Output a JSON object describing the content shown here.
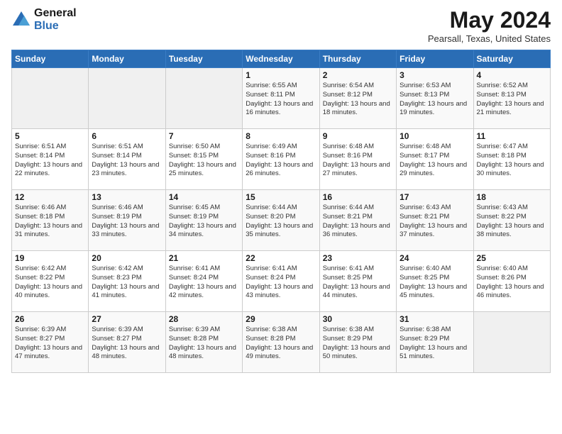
{
  "header": {
    "logo_line1": "General",
    "logo_line2": "Blue",
    "month_title": "May 2024",
    "location": "Pearsall, Texas, United States"
  },
  "weekdays": [
    "Sunday",
    "Monday",
    "Tuesday",
    "Wednesday",
    "Thursday",
    "Friday",
    "Saturday"
  ],
  "weeks": [
    [
      {
        "day": "",
        "info": ""
      },
      {
        "day": "",
        "info": ""
      },
      {
        "day": "",
        "info": ""
      },
      {
        "day": "1",
        "info": "Sunrise: 6:55 AM\nSunset: 8:11 PM\nDaylight: 13 hours and 16 minutes."
      },
      {
        "day": "2",
        "info": "Sunrise: 6:54 AM\nSunset: 8:12 PM\nDaylight: 13 hours and 18 minutes."
      },
      {
        "day": "3",
        "info": "Sunrise: 6:53 AM\nSunset: 8:13 PM\nDaylight: 13 hours and 19 minutes."
      },
      {
        "day": "4",
        "info": "Sunrise: 6:52 AM\nSunset: 8:13 PM\nDaylight: 13 hours and 21 minutes."
      }
    ],
    [
      {
        "day": "5",
        "info": "Sunrise: 6:51 AM\nSunset: 8:14 PM\nDaylight: 13 hours and 22 minutes."
      },
      {
        "day": "6",
        "info": "Sunrise: 6:51 AM\nSunset: 8:14 PM\nDaylight: 13 hours and 23 minutes."
      },
      {
        "day": "7",
        "info": "Sunrise: 6:50 AM\nSunset: 8:15 PM\nDaylight: 13 hours and 25 minutes."
      },
      {
        "day": "8",
        "info": "Sunrise: 6:49 AM\nSunset: 8:16 PM\nDaylight: 13 hours and 26 minutes."
      },
      {
        "day": "9",
        "info": "Sunrise: 6:48 AM\nSunset: 8:16 PM\nDaylight: 13 hours and 27 minutes."
      },
      {
        "day": "10",
        "info": "Sunrise: 6:48 AM\nSunset: 8:17 PM\nDaylight: 13 hours and 29 minutes."
      },
      {
        "day": "11",
        "info": "Sunrise: 6:47 AM\nSunset: 8:18 PM\nDaylight: 13 hours and 30 minutes."
      }
    ],
    [
      {
        "day": "12",
        "info": "Sunrise: 6:46 AM\nSunset: 8:18 PM\nDaylight: 13 hours and 31 minutes."
      },
      {
        "day": "13",
        "info": "Sunrise: 6:46 AM\nSunset: 8:19 PM\nDaylight: 13 hours and 33 minutes."
      },
      {
        "day": "14",
        "info": "Sunrise: 6:45 AM\nSunset: 8:19 PM\nDaylight: 13 hours and 34 minutes."
      },
      {
        "day": "15",
        "info": "Sunrise: 6:44 AM\nSunset: 8:20 PM\nDaylight: 13 hours and 35 minutes."
      },
      {
        "day": "16",
        "info": "Sunrise: 6:44 AM\nSunset: 8:21 PM\nDaylight: 13 hours and 36 minutes."
      },
      {
        "day": "17",
        "info": "Sunrise: 6:43 AM\nSunset: 8:21 PM\nDaylight: 13 hours and 37 minutes."
      },
      {
        "day": "18",
        "info": "Sunrise: 6:43 AM\nSunset: 8:22 PM\nDaylight: 13 hours and 38 minutes."
      }
    ],
    [
      {
        "day": "19",
        "info": "Sunrise: 6:42 AM\nSunset: 8:22 PM\nDaylight: 13 hours and 40 minutes."
      },
      {
        "day": "20",
        "info": "Sunrise: 6:42 AM\nSunset: 8:23 PM\nDaylight: 13 hours and 41 minutes."
      },
      {
        "day": "21",
        "info": "Sunrise: 6:41 AM\nSunset: 8:24 PM\nDaylight: 13 hours and 42 minutes."
      },
      {
        "day": "22",
        "info": "Sunrise: 6:41 AM\nSunset: 8:24 PM\nDaylight: 13 hours and 43 minutes."
      },
      {
        "day": "23",
        "info": "Sunrise: 6:41 AM\nSunset: 8:25 PM\nDaylight: 13 hours and 44 minutes."
      },
      {
        "day": "24",
        "info": "Sunrise: 6:40 AM\nSunset: 8:25 PM\nDaylight: 13 hours and 45 minutes."
      },
      {
        "day": "25",
        "info": "Sunrise: 6:40 AM\nSunset: 8:26 PM\nDaylight: 13 hours and 46 minutes."
      }
    ],
    [
      {
        "day": "26",
        "info": "Sunrise: 6:39 AM\nSunset: 8:27 PM\nDaylight: 13 hours and 47 minutes."
      },
      {
        "day": "27",
        "info": "Sunrise: 6:39 AM\nSunset: 8:27 PM\nDaylight: 13 hours and 48 minutes."
      },
      {
        "day": "28",
        "info": "Sunrise: 6:39 AM\nSunset: 8:28 PM\nDaylight: 13 hours and 48 minutes."
      },
      {
        "day": "29",
        "info": "Sunrise: 6:38 AM\nSunset: 8:28 PM\nDaylight: 13 hours and 49 minutes."
      },
      {
        "day": "30",
        "info": "Sunrise: 6:38 AM\nSunset: 8:29 PM\nDaylight: 13 hours and 50 minutes."
      },
      {
        "day": "31",
        "info": "Sunrise: 6:38 AM\nSunset: 8:29 PM\nDaylight: 13 hours and 51 minutes."
      },
      {
        "day": "",
        "info": ""
      }
    ]
  ]
}
